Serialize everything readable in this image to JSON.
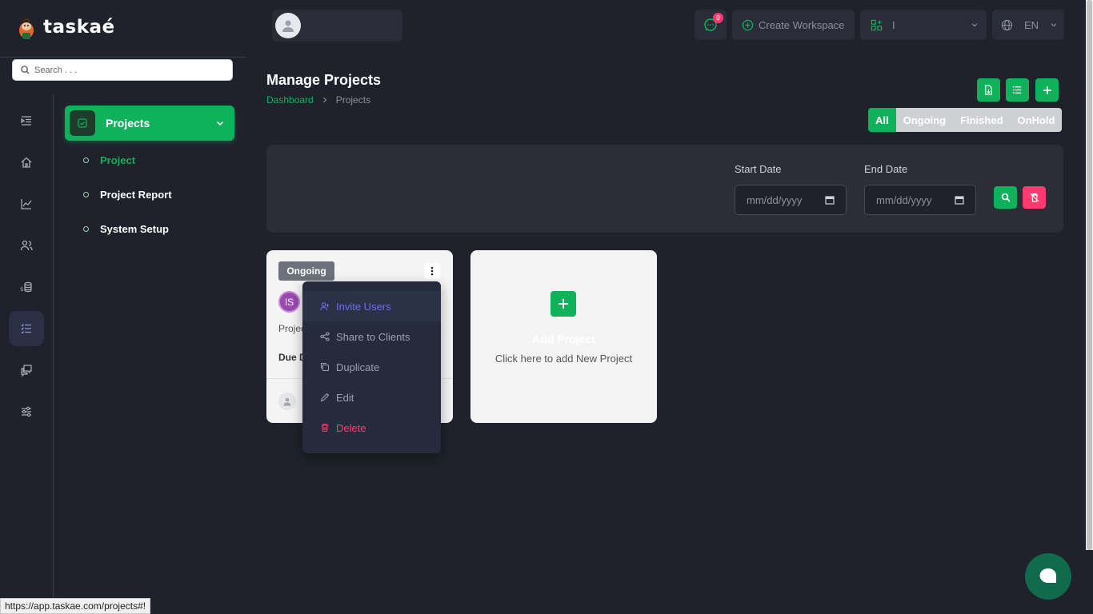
{
  "app": {
    "logo_text": "taskaé",
    "accent": "#10b15b"
  },
  "sidebar": {
    "search_placeholder": "Search . . .",
    "rail_icons": [
      "indent-icon",
      "home-icon",
      "chart-icon",
      "users-icon",
      "budget-icon",
      "tasks-list-icon",
      "messages-icon",
      "settings-sliders-icon"
    ],
    "group_label": "Projects",
    "sub_items": [
      {
        "label": "Project",
        "active": true
      },
      {
        "label": "Project Report",
        "active": false
      },
      {
        "label": "System Setup",
        "active": false
      }
    ]
  },
  "topbar": {
    "notification_count": "0",
    "create_workspace": "Create Workspace",
    "workspace_value": "I",
    "language": "EN"
  },
  "page": {
    "title": "Manage Projects",
    "breadcrumb": {
      "home": "Dashboard",
      "current": "Projects"
    },
    "filters": [
      "All",
      "Ongoing",
      "Finished",
      "OnHold"
    ],
    "start_date_label": "Start Date",
    "end_date_label": "End Date",
    "date_placeholder": "mm/dd/yyyy"
  },
  "project_card": {
    "status": "Ongoing",
    "initials": "IS",
    "project_text": "Projec",
    "due_text": "Due D"
  },
  "dropdown_menu": {
    "items": [
      "Invite Users",
      "Share to Clients",
      "Duplicate",
      "Edit",
      "Delete"
    ]
  },
  "add_card": {
    "title": "Add Project",
    "subtitle": "Click here to add New Project"
  },
  "status_bar_url": "https://app.taskae.com/projects#!"
}
